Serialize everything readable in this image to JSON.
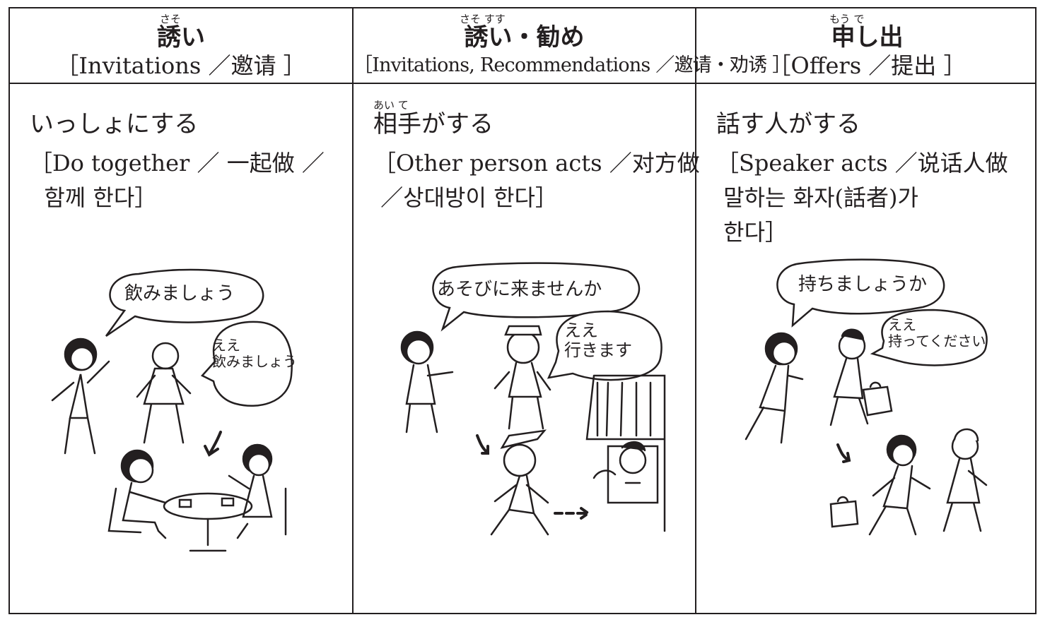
{
  "columns": [
    {
      "ruby": "さそ",
      "title": "誘い",
      "translation": "［Invitations ／邀请 ］",
      "body_ruby": "",
      "body_title": "いっしょにする",
      "body_desc": "［Do together ／ 一起做 ／\n  함께 한다］",
      "bubbles": [
        "飲みましょう",
        "ええ\n飲みましょう"
      ]
    },
    {
      "ruby": "さそ    すす",
      "title": "誘い・勧め",
      "translation": "［Invitations, Recommendations ／邀请・劝诱 ］",
      "body_ruby": "あい て",
      "body_title": "相手がする",
      "body_desc": "［Other person acts ／对方做\n ／상대방이 한다］",
      "bubbles": [
        "あそびに来ませんか",
        "ええ\n行きます"
      ]
    },
    {
      "ruby": "もう    で",
      "title": "申し出",
      "translation": "［Offers ／提出 ］",
      "body_ruby": "",
      "body_title": "話す人がする",
      "body_desc": "［Speaker acts ／说话人做\n 말하는 화자(話者)가\n 한다］",
      "bubbles": [
        "持ちましょうか",
        "ええ\n持ってください"
      ]
    }
  ]
}
